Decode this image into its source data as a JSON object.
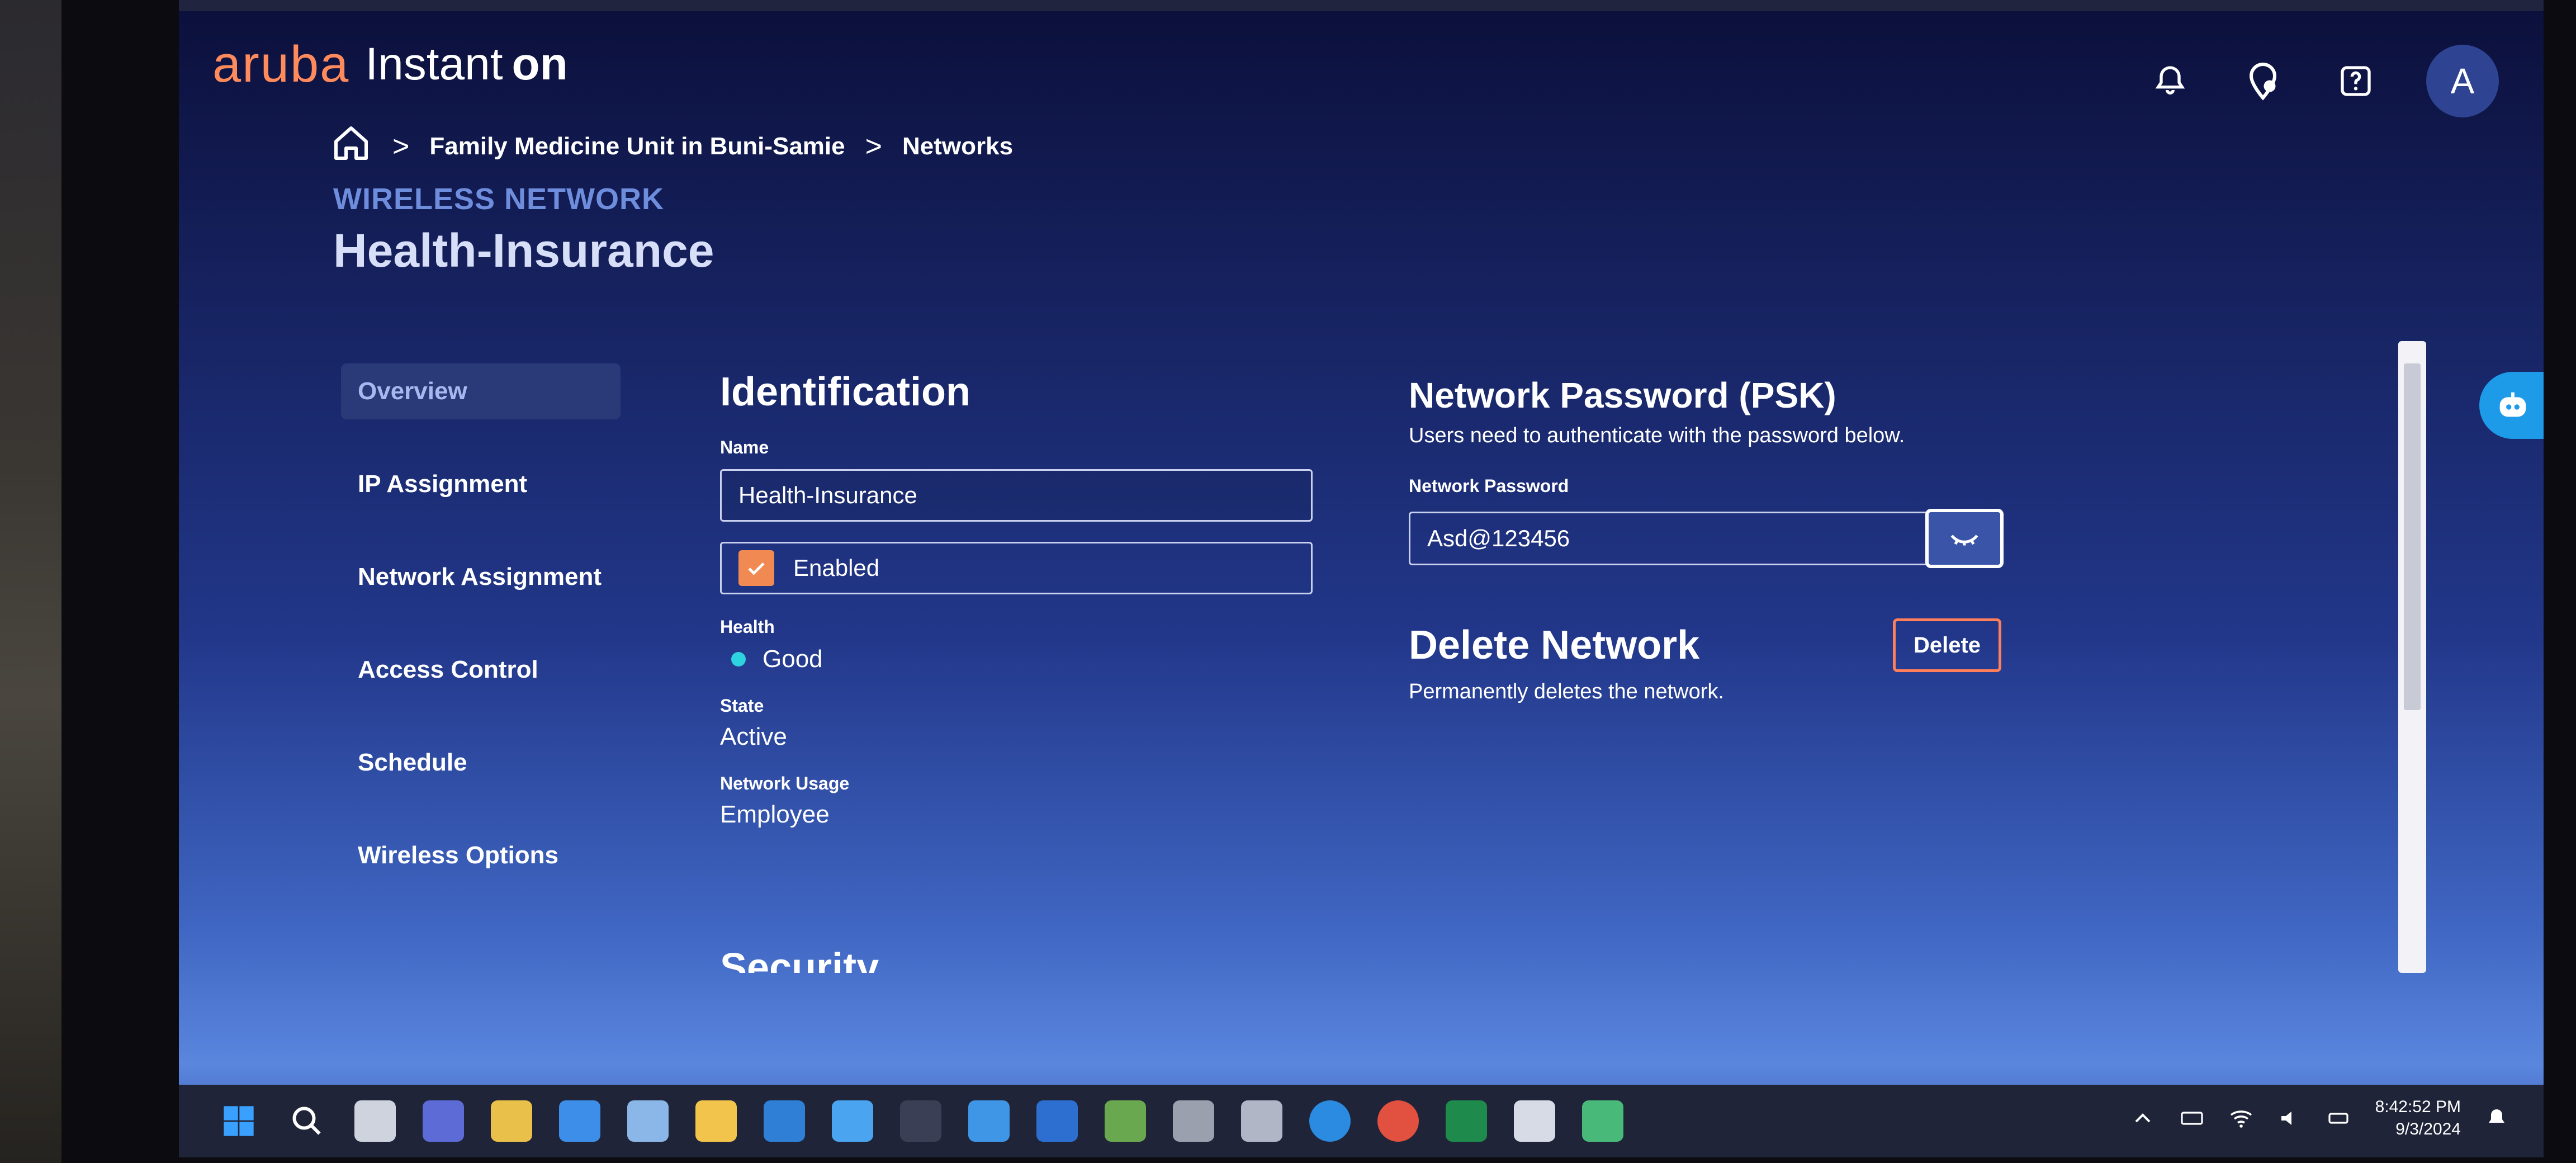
{
  "app": {
    "brand": "aruba",
    "product_a": "Instant",
    "product_b": "on"
  },
  "header": {
    "avatar_letter": "A"
  },
  "breadcrumb": {
    "items": [
      "Family Medicine Unit in Buni-Samie",
      "Networks"
    ],
    "separator": ">"
  },
  "page": {
    "section_label": "WIRELESS NETWORK",
    "title": "Health-Insurance"
  },
  "sidebar": {
    "items": [
      {
        "label": "Overview",
        "active": true
      },
      {
        "label": "IP Assignment"
      },
      {
        "label": "Network Assignment"
      },
      {
        "label": "Access Control"
      },
      {
        "label": "Schedule"
      },
      {
        "label": "Wireless Options"
      }
    ]
  },
  "identification": {
    "heading": "Identification",
    "name_label": "Name",
    "name_value": "Health-Insurance",
    "enabled_label": "Enabled",
    "health_label": "Health",
    "health_value": "Good",
    "state_label": "State",
    "state_value": "Active",
    "usage_label": "Network Usage",
    "usage_value": "Employee",
    "next_heading": "Security"
  },
  "psk": {
    "heading": "Network Password (PSK)",
    "description": "Users need to authenticate with the password below.",
    "field_label": "Network Password",
    "value": "Asd@123456"
  },
  "delete": {
    "heading": "Delete Network",
    "description": "Permanently deletes the network.",
    "button_label": "Delete"
  },
  "taskbar": {
    "time": "8:42:52 PM",
    "date": "9/3/2024"
  },
  "colors": {
    "brand_orange": "#ff8a5c",
    "accent_blue": "#6f8ddd",
    "delete_border": "#ff7f5a",
    "health_good": "#2ed3e0",
    "checkbox": "#f08a52"
  }
}
